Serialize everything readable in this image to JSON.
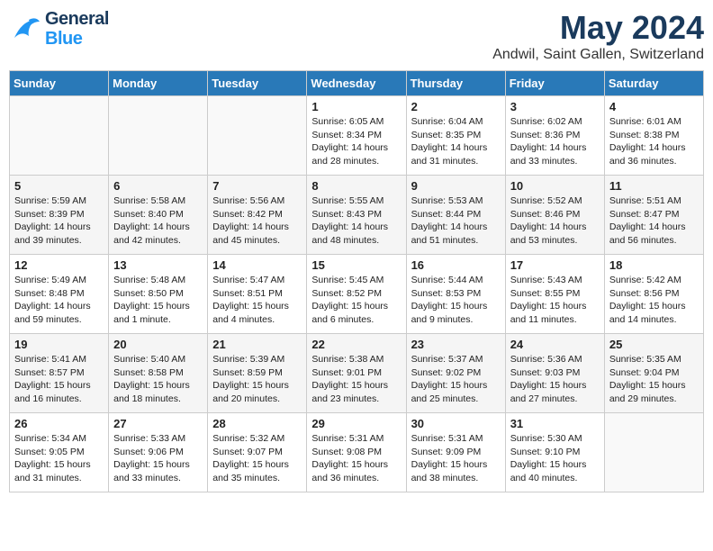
{
  "header": {
    "logo_general": "General",
    "logo_blue": "Blue",
    "month": "May 2024",
    "location": "Andwil, Saint Gallen, Switzerland"
  },
  "days_of_week": [
    "Sunday",
    "Monday",
    "Tuesday",
    "Wednesday",
    "Thursday",
    "Friday",
    "Saturday"
  ],
  "weeks": [
    [
      {
        "day": "",
        "content": ""
      },
      {
        "day": "",
        "content": ""
      },
      {
        "day": "",
        "content": ""
      },
      {
        "day": "1",
        "content": "Sunrise: 6:05 AM\nSunset: 8:34 PM\nDaylight: 14 hours\nand 28 minutes."
      },
      {
        "day": "2",
        "content": "Sunrise: 6:04 AM\nSunset: 8:35 PM\nDaylight: 14 hours\nand 31 minutes."
      },
      {
        "day": "3",
        "content": "Sunrise: 6:02 AM\nSunset: 8:36 PM\nDaylight: 14 hours\nand 33 minutes."
      },
      {
        "day": "4",
        "content": "Sunrise: 6:01 AM\nSunset: 8:38 PM\nDaylight: 14 hours\nand 36 minutes."
      }
    ],
    [
      {
        "day": "5",
        "content": "Sunrise: 5:59 AM\nSunset: 8:39 PM\nDaylight: 14 hours\nand 39 minutes."
      },
      {
        "day": "6",
        "content": "Sunrise: 5:58 AM\nSunset: 8:40 PM\nDaylight: 14 hours\nand 42 minutes."
      },
      {
        "day": "7",
        "content": "Sunrise: 5:56 AM\nSunset: 8:42 PM\nDaylight: 14 hours\nand 45 minutes."
      },
      {
        "day": "8",
        "content": "Sunrise: 5:55 AM\nSunset: 8:43 PM\nDaylight: 14 hours\nand 48 minutes."
      },
      {
        "day": "9",
        "content": "Sunrise: 5:53 AM\nSunset: 8:44 PM\nDaylight: 14 hours\nand 51 minutes."
      },
      {
        "day": "10",
        "content": "Sunrise: 5:52 AM\nSunset: 8:46 PM\nDaylight: 14 hours\nand 53 minutes."
      },
      {
        "day": "11",
        "content": "Sunrise: 5:51 AM\nSunset: 8:47 PM\nDaylight: 14 hours\nand 56 minutes."
      }
    ],
    [
      {
        "day": "12",
        "content": "Sunrise: 5:49 AM\nSunset: 8:48 PM\nDaylight: 14 hours\nand 59 minutes."
      },
      {
        "day": "13",
        "content": "Sunrise: 5:48 AM\nSunset: 8:50 PM\nDaylight: 15 hours\nand 1 minute."
      },
      {
        "day": "14",
        "content": "Sunrise: 5:47 AM\nSunset: 8:51 PM\nDaylight: 15 hours\nand 4 minutes."
      },
      {
        "day": "15",
        "content": "Sunrise: 5:45 AM\nSunset: 8:52 PM\nDaylight: 15 hours\nand 6 minutes."
      },
      {
        "day": "16",
        "content": "Sunrise: 5:44 AM\nSunset: 8:53 PM\nDaylight: 15 hours\nand 9 minutes."
      },
      {
        "day": "17",
        "content": "Sunrise: 5:43 AM\nSunset: 8:55 PM\nDaylight: 15 hours\nand 11 minutes."
      },
      {
        "day": "18",
        "content": "Sunrise: 5:42 AM\nSunset: 8:56 PM\nDaylight: 15 hours\nand 14 minutes."
      }
    ],
    [
      {
        "day": "19",
        "content": "Sunrise: 5:41 AM\nSunset: 8:57 PM\nDaylight: 15 hours\nand 16 minutes."
      },
      {
        "day": "20",
        "content": "Sunrise: 5:40 AM\nSunset: 8:58 PM\nDaylight: 15 hours\nand 18 minutes."
      },
      {
        "day": "21",
        "content": "Sunrise: 5:39 AM\nSunset: 8:59 PM\nDaylight: 15 hours\nand 20 minutes."
      },
      {
        "day": "22",
        "content": "Sunrise: 5:38 AM\nSunset: 9:01 PM\nDaylight: 15 hours\nand 23 minutes."
      },
      {
        "day": "23",
        "content": "Sunrise: 5:37 AM\nSunset: 9:02 PM\nDaylight: 15 hours\nand 25 minutes."
      },
      {
        "day": "24",
        "content": "Sunrise: 5:36 AM\nSunset: 9:03 PM\nDaylight: 15 hours\nand 27 minutes."
      },
      {
        "day": "25",
        "content": "Sunrise: 5:35 AM\nSunset: 9:04 PM\nDaylight: 15 hours\nand 29 minutes."
      }
    ],
    [
      {
        "day": "26",
        "content": "Sunrise: 5:34 AM\nSunset: 9:05 PM\nDaylight: 15 hours\nand 31 minutes."
      },
      {
        "day": "27",
        "content": "Sunrise: 5:33 AM\nSunset: 9:06 PM\nDaylight: 15 hours\nand 33 minutes."
      },
      {
        "day": "28",
        "content": "Sunrise: 5:32 AM\nSunset: 9:07 PM\nDaylight: 15 hours\nand 35 minutes."
      },
      {
        "day": "29",
        "content": "Sunrise: 5:31 AM\nSunset: 9:08 PM\nDaylight: 15 hours\nand 36 minutes."
      },
      {
        "day": "30",
        "content": "Sunrise: 5:31 AM\nSunset: 9:09 PM\nDaylight: 15 hours\nand 38 minutes."
      },
      {
        "day": "31",
        "content": "Sunrise: 5:30 AM\nSunset: 9:10 PM\nDaylight: 15 hours\nand 40 minutes."
      },
      {
        "day": "",
        "content": ""
      }
    ]
  ]
}
